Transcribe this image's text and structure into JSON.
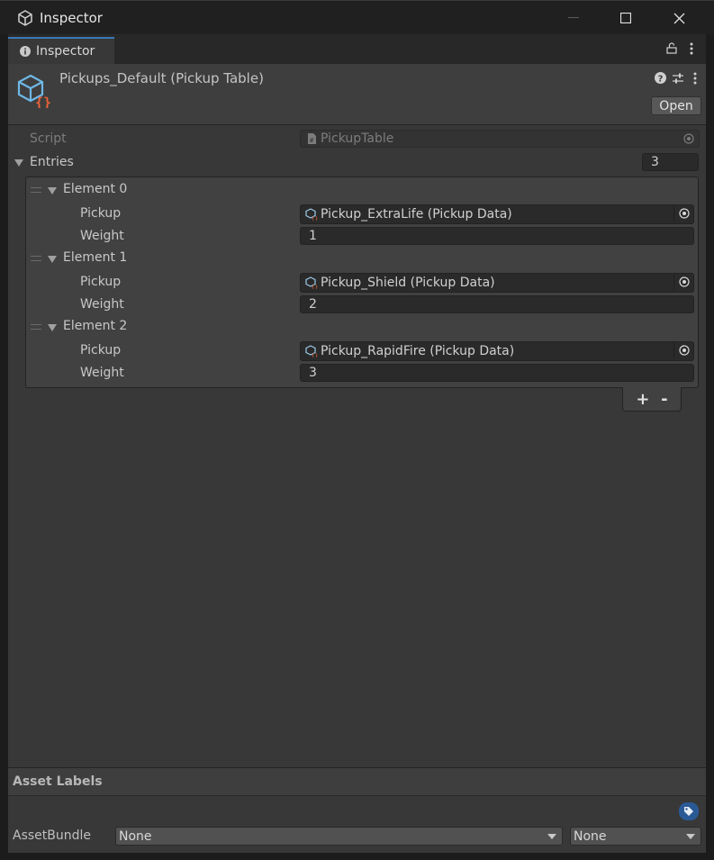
{
  "window": {
    "title": "Inspector"
  },
  "tab": {
    "label": "Inspector"
  },
  "header": {
    "asset_title": "Pickups_Default (Pickup Table)",
    "open_label": "Open"
  },
  "script": {
    "label": "Script",
    "value": "PickupTable"
  },
  "entries": {
    "label": "Entries",
    "count": "3",
    "elements": [
      {
        "name": "Element 0",
        "pickup_label": "Pickup",
        "pickup_value": "Pickup_ExtraLife (Pickup Data)",
        "weight_label": "Weight",
        "weight_value": "1"
      },
      {
        "name": "Element 1",
        "pickup_label": "Pickup",
        "pickup_value": "Pickup_Shield (Pickup Data)",
        "weight_label": "Weight",
        "weight_value": "2"
      },
      {
        "name": "Element 2",
        "pickup_label": "Pickup",
        "pickup_value": "Pickup_RapidFire (Pickup Data)",
        "weight_label": "Weight",
        "weight_value": "3"
      }
    ],
    "add_label": "+",
    "remove_label": "-"
  },
  "footer": {
    "asset_labels_title": "Asset Labels",
    "assetbundle_label": "AssetBundle",
    "bundle_name": "None",
    "bundle_variant": "None"
  },
  "colors": {
    "accent": "#3a79bb",
    "background": "#383838",
    "field": "#2a2a2a",
    "asset_icon_brace": "#e8623a",
    "asset_icon_cube": "#6fb8e6"
  }
}
